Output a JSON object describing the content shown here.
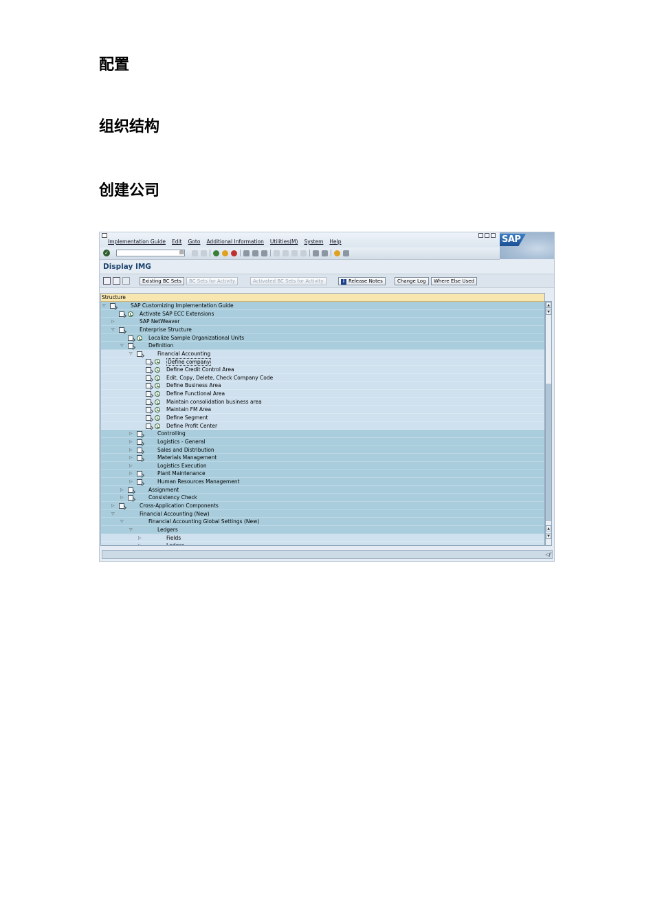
{
  "document": {
    "heading1": "配置",
    "heading2": "组织结构",
    "heading3": "创建公司"
  },
  "sap": {
    "menu": [
      "Implementation Guide",
      "Edit",
      "Goto",
      "Additional Information",
      "Utilities(M)",
      "System",
      "Help"
    ],
    "logo_text": "SAP",
    "screen_title": "Display IMG",
    "toolbar": {
      "existing_bc_sets": "Existing BC Sets",
      "bc_sets_for_activity": "BC Sets for Activity",
      "activated_bc_sets": "Activated BC Sets for Activity",
      "release_notes": "Release Notes",
      "change_log": "Change Log",
      "where_else_used": "Where Else Used"
    },
    "tree": {
      "header": "Structure",
      "rows": [
        {
          "label": "SAP Customizing Implementation Guide",
          "level": 0,
          "toggle": "open",
          "doc": true,
          "clock": false,
          "shade": "dark"
        },
        {
          "label": "Activate SAP ECC Extensions",
          "level": 1,
          "toggle": "none",
          "doc": true,
          "clock": true,
          "shade": "dark"
        },
        {
          "label": "SAP NetWeaver",
          "level": 1,
          "toggle": "closed",
          "doc": false,
          "clock": false,
          "shade": "dark"
        },
        {
          "label": "Enterprise Structure",
          "level": 1,
          "toggle": "open",
          "doc": true,
          "clock": false,
          "shade": "dark"
        },
        {
          "label": "Localize Sample Organizational Units",
          "level": 2,
          "toggle": "none",
          "doc": true,
          "clock": true,
          "shade": "dark"
        },
        {
          "label": "Definition",
          "level": 2,
          "toggle": "open",
          "doc": true,
          "clock": false,
          "shade": "dark"
        },
        {
          "label": "Financial Accounting",
          "level": 3,
          "toggle": "open",
          "doc": true,
          "clock": false,
          "shade": "light"
        },
        {
          "label": "Define company",
          "level": 4,
          "toggle": "none",
          "doc": true,
          "clock": true,
          "shade": "light",
          "selected": true
        },
        {
          "label": "Define Credit Control Area",
          "level": 4,
          "toggle": "none",
          "doc": true,
          "clock": true,
          "shade": "light"
        },
        {
          "label": "Edit, Copy, Delete, Check Company Code",
          "level": 4,
          "toggle": "none",
          "doc": true,
          "clock": true,
          "shade": "light"
        },
        {
          "label": "Define Business Area",
          "level": 4,
          "toggle": "none",
          "doc": true,
          "clock": true,
          "shade": "light"
        },
        {
          "label": "Define Functional Area",
          "level": 4,
          "toggle": "none",
          "doc": true,
          "clock": true,
          "shade": "light"
        },
        {
          "label": "Maintain consolidation business area",
          "level": 4,
          "toggle": "none",
          "doc": true,
          "clock": true,
          "shade": "light"
        },
        {
          "label": "Maintain FM Area",
          "level": 4,
          "toggle": "none",
          "doc": true,
          "clock": true,
          "shade": "light"
        },
        {
          "label": "Define Segment",
          "level": 4,
          "toggle": "none",
          "doc": true,
          "clock": true,
          "shade": "light"
        },
        {
          "label": "Define Profit Center",
          "level": 4,
          "toggle": "none",
          "doc": true,
          "clock": true,
          "shade": "light"
        },
        {
          "label": "Controlling",
          "level": 3,
          "toggle": "closed",
          "doc": true,
          "clock": false,
          "shade": "dark"
        },
        {
          "label": "Logistics - General",
          "level": 3,
          "toggle": "closed",
          "doc": true,
          "clock": false,
          "shade": "dark"
        },
        {
          "label": "Sales and Distribution",
          "level": 3,
          "toggle": "closed",
          "doc": true,
          "clock": false,
          "shade": "dark"
        },
        {
          "label": "Materials Management",
          "level": 3,
          "toggle": "closed",
          "doc": true,
          "clock": false,
          "shade": "dark"
        },
        {
          "label": "Logistics Execution",
          "level": 3,
          "toggle": "closed",
          "doc": false,
          "clock": false,
          "shade": "dark"
        },
        {
          "label": "Plant Maintenance",
          "level": 3,
          "toggle": "closed",
          "doc": true,
          "clock": false,
          "shade": "dark"
        },
        {
          "label": "Human Resources Management",
          "level": 3,
          "toggle": "closed",
          "doc": true,
          "clock": false,
          "shade": "dark"
        },
        {
          "label": "Assignment",
          "level": 2,
          "toggle": "closed",
          "doc": true,
          "clock": false,
          "shade": "dark"
        },
        {
          "label": "Consistency Check",
          "level": 2,
          "toggle": "closed",
          "doc": true,
          "clock": false,
          "shade": "dark"
        },
        {
          "label": "Cross-Application Components",
          "level": 1,
          "toggle": "closed",
          "doc": true,
          "clock": false,
          "shade": "dark"
        },
        {
          "label": "Financial Accounting (New)",
          "level": 1,
          "toggle": "open",
          "doc": false,
          "clock": false,
          "shade": "dark"
        },
        {
          "label": "Financial Accounting Global Settings (New)",
          "level": 2,
          "toggle": "open",
          "doc": false,
          "clock": false,
          "shade": "dark"
        },
        {
          "label": "Ledgers",
          "level": 3,
          "toggle": "open",
          "doc": false,
          "clock": false,
          "shade": "dark"
        },
        {
          "label": "Fields",
          "level": 4,
          "toggle": "closed",
          "doc": false,
          "clock": false,
          "shade": "light"
        },
        {
          "label": "Ledger",
          "level": 4,
          "toggle": "closed",
          "doc": false,
          "clock": false,
          "shade": "light"
        }
      ]
    }
  }
}
